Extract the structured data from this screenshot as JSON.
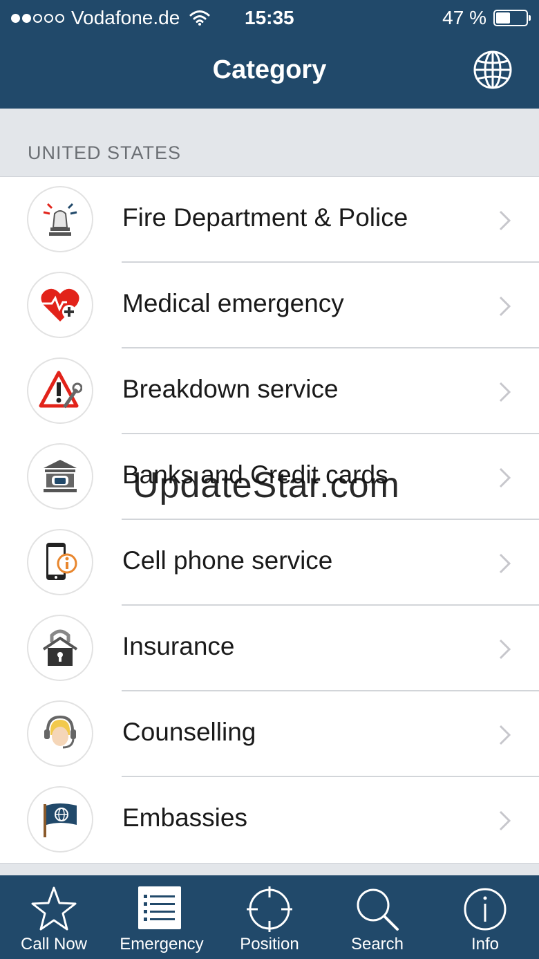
{
  "status_bar": {
    "carrier": "Vodafone.de",
    "time": "15:35",
    "battery": "47 %",
    "signal_bars": 2
  },
  "header": {
    "title": "Category",
    "globe_icon": "globe-icon"
  },
  "section_title": "UNITED STATES",
  "categories": [
    {
      "label": "Fire Department & Police",
      "icon": "siren-icon"
    },
    {
      "label": "Medical emergency",
      "icon": "heart-medical-icon"
    },
    {
      "label": "Breakdown service",
      "icon": "warning-wrench-icon"
    },
    {
      "label": "Banks and Credit cards",
      "icon": "bank-icon"
    },
    {
      "label": "Cell phone service",
      "icon": "phone-info-icon"
    },
    {
      "label": "Insurance",
      "icon": "house-lock-icon"
    },
    {
      "label": "Counselling",
      "icon": "headset-person-icon"
    },
    {
      "label": "Embassies",
      "icon": "flag-globe-icon"
    }
  ],
  "watermark": "UpdateStar.com",
  "tabs": [
    {
      "label": "Call Now",
      "icon": "star-icon",
      "active": false
    },
    {
      "label": "Emergency",
      "icon": "list-icon",
      "active": true
    },
    {
      "label": "Position",
      "icon": "crosshair-icon",
      "active": false
    },
    {
      "label": "Search",
      "icon": "search-icon",
      "active": false
    },
    {
      "label": "Info",
      "icon": "info-icon",
      "active": false
    }
  ],
  "colors": {
    "bar": "#21496a",
    "accent_red": "#e2231a",
    "accent_orange": "#e8862d"
  }
}
